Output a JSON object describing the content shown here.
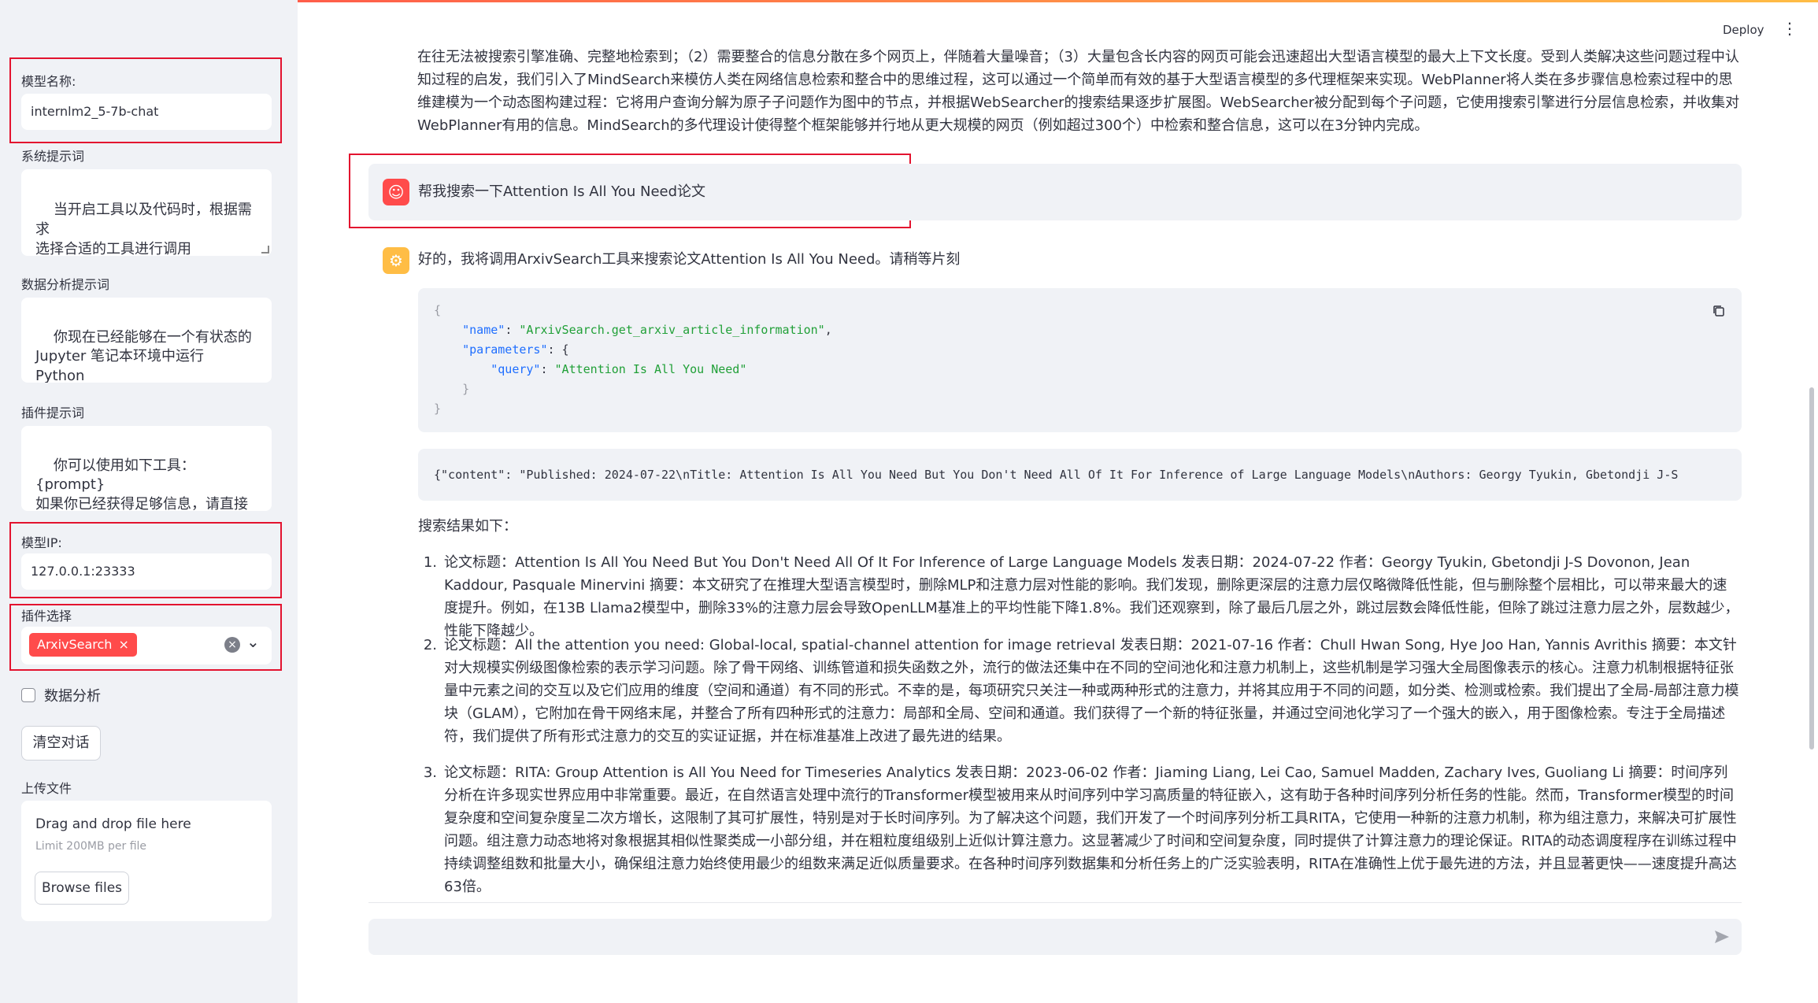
{
  "header": {
    "deploy_label": "Deploy",
    "menu_icon": "kebab-menu-icon"
  },
  "sidebar": {
    "model_name": {
      "label": "模型名称:",
      "value": "internlm2_5-7b-chat"
    },
    "system_prompt": {
      "label": "系统提示词",
      "value": "当开启工具以及代码时，根据需求\n选择合适的工具进行调用"
    },
    "data_prompt": {
      "label": "数据分析提示词",
      "value": "你现在已经能够在一个有状态的\nJupyter 笔记本环境中运行 Python\n代码。当你向 python 发送含有\nPython 代码的消息时，它将在该环"
    },
    "plugin_prompt": {
      "label": "插件提示词",
      "value": "你可以使用如下工具：\n{prompt}\n如果你已经获得足够信息，请直接\n给出答案.避免不必要的工具调用!"
    },
    "model_ip": {
      "label": "模型IP:",
      "value": "127.0.0.1:23333"
    },
    "plugin_select": {
      "label": "插件选择",
      "selected": "ArxivSearch",
      "remove_glyph": "×",
      "clear_glyph": "×",
      "open_glyph": "⌄"
    },
    "data_analysis": {
      "label": "数据分析",
      "checked": false
    },
    "clear_button": "清空对话",
    "upload": {
      "label": "上传文件",
      "drop_text": "Drag and drop file here",
      "limit_text": "Limit 200MB per file",
      "browse_button": "Browse files"
    }
  },
  "chat": {
    "intro_text": "在往无法被搜索引擎准确、完整地检索到；（2）需要整合的信息分散在多个网页上，伴随着大量噪音；（3）大量包含长内容的网页可能会迅速超出大型语言模型的最大上下文长度。受到人类解决这些问题过程中认知过程的启发，我们引入了MindSearch来模仿人类在网络信息检索和整合中的思维过程，这可以通过一个简单而有效的基于大型语言模型的多代理框架来实现。WebPlanner将人类在多步骤信息检索过程中的思维建模为一个动态图构建过程：它将用户查询分解为原子子问题作为图中的节点，并根据WebSearcher的搜索结果逐步扩展图。WebSearcher被分配到每个子问题，它使用搜索引擎进行分层信息检索，并收集对WebPlanner有用的信息。MindSearch的多代理设计使得整个框架能够并行地从更大规模的网页（例如超过300个）中检索和整合信息，这可以在3分钟内完成。",
    "user_message": "帮我搜索一下Attention Is All You Need论文",
    "bot_message": "好的，我将调用ArxivSearch工具来搜索论文Attention Is All You Need。请稍等片刻",
    "tool_call": {
      "open_brace": "{",
      "name_key": "\"name\"",
      "name_value": "\"ArxivSearch.get_arxiv_article_information\"",
      "params_key": "\"parameters\"",
      "query_key": "\"query\"",
      "query_value": "\"Attention Is All You Need\"",
      "inner_close": "}",
      "close_brace": "}"
    },
    "tool_result": "{\"content\": \"Published: 2024-07-22\\nTitle: Attention Is All You Need But You Don't Need All Of It For Inference of Large Language Models\\nAuthors: Georgy Tyukin, Gbetondji J-S",
    "results_heading": "搜索结果如下：",
    "results": [
      {
        "num": "1.",
        "text": "论文标题：Attention Is All You Need But You Don't Need All Of It For Inference of Large Language Models 发表日期：2024-07-22 作者：Georgy Tyukin, Gbetondji J-S Dovonon, Jean Kaddour, Pasquale Minervini 摘要：本文研究了在推理大型语言模型时，删除MLP和注意力层对性能的影响。我们发现，删除更深层的注意力层仅略微降低性能，但与删除整个层相比，可以带来最大的速度提升。例如，在13B Llama2模型中，删除33%的注意力层会导致OpenLLM基准上的平均性能下降1.8%。我们还观察到，除了最后几层之外，跳过层数会降低性能，但除了跳过注意力层之外，层数越少，性能下降越少。"
      },
      {
        "num": "2.",
        "text": "论文标题：All the attention you need: Global-local, spatial-channel attention for image retrieval 发表日期：2021-07-16 作者：Chull Hwan Song, Hye Joo Han, Yannis Avrithis 摘要：本文针对大规模实例级图像检索的表示学习问题。除了骨干网络、训练管道和损失函数之外，流行的做法还集中在不同的空间池化和注意力机制上，这些机制是学习强大全局图像表示的核心。注意力机制根据特征张量中元素之间的交互以及它们应用的维度（空间和通道）有不同的形式。不幸的是，每项研究只关注一种或两种形式的注意力，并将其应用于不同的问题，如分类、检测或检索。我们提出了全局-局部注意力模块（GLAM），它附加在骨干网络末尾，并整合了所有四种形式的注意力：局部和全局、空间和通道。我们获得了一个新的特征张量，并通过空间池化学习了一个强大的嵌入，用于图像检索。专注于全局描述符，我们提供了所有形式注意力的交互的实证证据，并在标准基准上改进了最先进的结果。"
      },
      {
        "num": "3.",
        "text": "论文标题：RITA: Group Attention is All You Need for Timeseries Analytics 发表日期：2023-06-02 作者：Jiaming Liang, Lei Cao, Samuel Madden, Zachary Ives, Guoliang Li 摘要：时间序列分析在许多现实世界应用中非常重要。最近，在自然语言处理中流行的Transformer模型被用来从时间序列中学习高质量的特征嵌入，这有助于各种时间序列分析任务的性能。然而，Transformer模型的时间复杂度和空间复杂度呈二次方增长，这限制了其可扩展性，特别是对于长时间序列。为了解决这个问题，我们开发了一个时间序列分析工具RITA，它使用一种新的注意力机制，称为组注意力，来解决可扩展性问题。组注意力动态地将对象根据其相似性聚类成一小部分组，并在粗粒度组级别上近似计算注意力。这显著减少了时间和空间复杂度，同时提供了计算注意力的理论保证。RITA的动态调度程序在训练过程中持续调整组数和批量大小，确保组注意力始终使用最少的组数来满足近似质量要求。在各种时间序列数据集和分析任务上的广泛实验表明，RITA在准确性上优于最先进的方法，并且显著更快——速度提升高达63倍。"
      }
    ],
    "input_placeholder": ""
  },
  "colors": {
    "accent": "#ff4b4b",
    "highlight_frame": "#e3132f",
    "bot_avatar": "#ffbd45",
    "sidebar_bg": "#f0f2f6"
  }
}
